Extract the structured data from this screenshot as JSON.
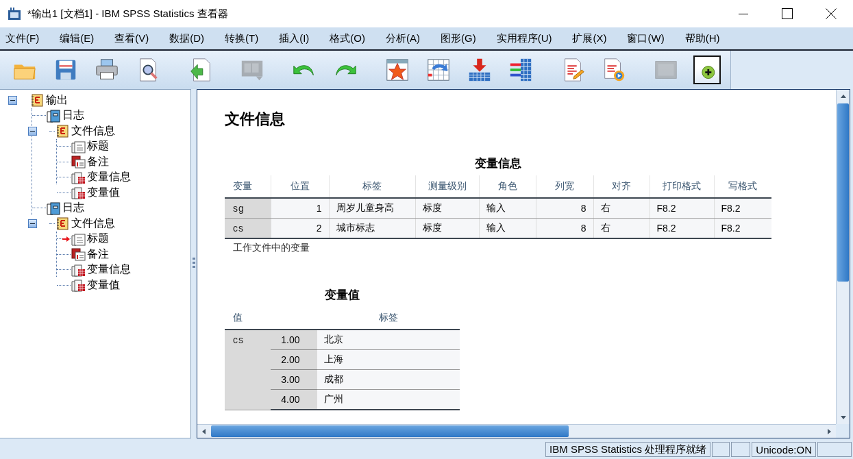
{
  "window": {
    "title": "*输出1 [文档1] - IBM SPSS Statistics 查看器"
  },
  "menu": [
    {
      "label": "文件(F)"
    },
    {
      "label": "编辑(E)"
    },
    {
      "label": "查看(V)"
    },
    {
      "label": "数据(D)"
    },
    {
      "label": "转换(T)"
    },
    {
      "label": "插入(I)"
    },
    {
      "label": "格式(O)"
    },
    {
      "label": "分析(A)"
    },
    {
      "label": "图形(G)"
    },
    {
      "label": "实用程序(U)"
    },
    {
      "label": "扩展(X)"
    },
    {
      "label": "窗口(W)"
    },
    {
      "label": "帮助(H)"
    }
  ],
  "toolbar": [
    [
      {
        "kind": "open",
        "disabled": false,
        "pressed": false
      },
      {
        "kind": "save",
        "disabled": false,
        "pressed": false
      },
      {
        "kind": "print",
        "disabled": false,
        "pressed": false
      },
      {
        "kind": "preview",
        "disabled": false,
        "pressed": false
      }
    ],
    [
      {
        "kind": "export",
        "disabled": false,
        "pressed": false
      }
    ],
    [
      {
        "kind": "dialog",
        "disabled": true,
        "pressed": false
      }
    ],
    [
      {
        "kind": "undo",
        "disabled": false,
        "pressed": false
      },
      {
        "kind": "redo",
        "disabled": false,
        "pressed": false
      }
    ],
    [
      {
        "kind": "star",
        "disabled": false,
        "pressed": false
      },
      {
        "kind": "goto",
        "disabled": false,
        "pressed": false
      },
      {
        "kind": "insert",
        "disabled": false,
        "pressed": false
      },
      {
        "kind": "variables",
        "disabled": false,
        "pressed": false
      }
    ],
    [
      {
        "kind": "script",
        "disabled": false,
        "pressed": false
      },
      {
        "kind": "run",
        "disabled": false,
        "pressed": false
      }
    ],
    [
      {
        "kind": "frame",
        "disabled": true,
        "pressed": false
      },
      {
        "kind": "designate",
        "disabled": false,
        "pressed": true
      }
    ]
  ],
  "outline": [
    {
      "label": "输出",
      "kind": "output",
      "expanded": true,
      "current": false,
      "children": [
        {
          "label": "日志",
          "kind": "log",
          "current": false
        },
        {
          "label": "文件信息",
          "kind": "output",
          "expanded": true,
          "current": false,
          "children": [
            {
              "label": "标题",
              "kind": "title",
              "current": false
            },
            {
              "label": "备注",
              "kind": "notes",
              "current": false
            },
            {
              "label": "变量信息",
              "kind": "table",
              "current": false
            },
            {
              "label": "变量值",
              "kind": "table",
              "current": false
            }
          ]
        },
        {
          "label": "日志",
          "kind": "log",
          "current": false
        },
        {
          "label": "文件信息",
          "kind": "output",
          "expanded": true,
          "current": false,
          "children": [
            {
              "label": "标题",
              "kind": "title",
              "current": true
            },
            {
              "label": "备注",
              "kind": "notes",
              "current": false
            },
            {
              "label": "变量信息",
              "kind": "table",
              "current": false
            },
            {
              "label": "变量值",
              "kind": "table",
              "current": false
            }
          ]
        }
      ]
    }
  ],
  "document": {
    "heading": "文件信息",
    "variable_info": {
      "title": "变量信息",
      "columns": [
        "变量",
        "位置",
        "标签",
        "测量级别",
        "角色",
        "列宽",
        "对齐",
        "打印格式",
        "写格式"
      ],
      "rows": [
        [
          "sg",
          "1",
          "周岁儿童身高",
          "标度",
          "输入",
          "8",
          "右",
          "F8.2",
          "F8.2"
        ],
        [
          "cs",
          "2",
          "城市标志",
          "标度",
          "输入",
          "8",
          "右",
          "F8.2",
          "F8.2"
        ]
      ],
      "footnote": "工作文件中的变量"
    },
    "variable_values": {
      "title": "变量值",
      "columns": [
        "值",
        "标签"
      ],
      "groups": [
        {
          "variable": "cs",
          "values": [
            {
              "value": "1.00",
              "label": "北京"
            },
            {
              "value": "2.00",
              "label": "上海"
            },
            {
              "value": "3.00",
              "label": "成都"
            },
            {
              "value": "4.00",
              "label": "广州"
            }
          ]
        }
      ]
    }
  },
  "status_bar": {
    "message": "IBM SPSS Statistics 处理程序就绪",
    "encoding": "Unicode:ON"
  }
}
